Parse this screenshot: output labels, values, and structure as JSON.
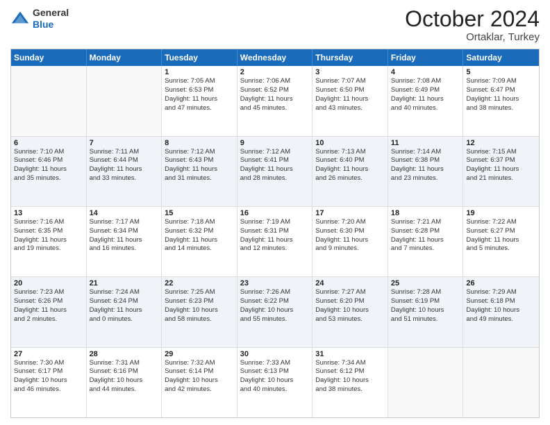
{
  "logo": {
    "general": "General",
    "blue": "Blue"
  },
  "title": "October 2024",
  "location": "Ortaklar, Turkey",
  "weekdays": [
    "Sunday",
    "Monday",
    "Tuesday",
    "Wednesday",
    "Thursday",
    "Friday",
    "Saturday"
  ],
  "rows": [
    [
      {
        "day": "",
        "lines": []
      },
      {
        "day": "",
        "lines": []
      },
      {
        "day": "1",
        "lines": [
          "Sunrise: 7:05 AM",
          "Sunset: 6:53 PM",
          "Daylight: 11 hours",
          "and 47 minutes."
        ]
      },
      {
        "day": "2",
        "lines": [
          "Sunrise: 7:06 AM",
          "Sunset: 6:52 PM",
          "Daylight: 11 hours",
          "and 45 minutes."
        ]
      },
      {
        "day": "3",
        "lines": [
          "Sunrise: 7:07 AM",
          "Sunset: 6:50 PM",
          "Daylight: 11 hours",
          "and 43 minutes."
        ]
      },
      {
        "day": "4",
        "lines": [
          "Sunrise: 7:08 AM",
          "Sunset: 6:49 PM",
          "Daylight: 11 hours",
          "and 40 minutes."
        ]
      },
      {
        "day": "5",
        "lines": [
          "Sunrise: 7:09 AM",
          "Sunset: 6:47 PM",
          "Daylight: 11 hours",
          "and 38 minutes."
        ]
      }
    ],
    [
      {
        "day": "6",
        "lines": [
          "Sunrise: 7:10 AM",
          "Sunset: 6:46 PM",
          "Daylight: 11 hours",
          "and 35 minutes."
        ]
      },
      {
        "day": "7",
        "lines": [
          "Sunrise: 7:11 AM",
          "Sunset: 6:44 PM",
          "Daylight: 11 hours",
          "and 33 minutes."
        ]
      },
      {
        "day": "8",
        "lines": [
          "Sunrise: 7:12 AM",
          "Sunset: 6:43 PM",
          "Daylight: 11 hours",
          "and 31 minutes."
        ]
      },
      {
        "day": "9",
        "lines": [
          "Sunrise: 7:12 AM",
          "Sunset: 6:41 PM",
          "Daylight: 11 hours",
          "and 28 minutes."
        ]
      },
      {
        "day": "10",
        "lines": [
          "Sunrise: 7:13 AM",
          "Sunset: 6:40 PM",
          "Daylight: 11 hours",
          "and 26 minutes."
        ]
      },
      {
        "day": "11",
        "lines": [
          "Sunrise: 7:14 AM",
          "Sunset: 6:38 PM",
          "Daylight: 11 hours",
          "and 23 minutes."
        ]
      },
      {
        "day": "12",
        "lines": [
          "Sunrise: 7:15 AM",
          "Sunset: 6:37 PM",
          "Daylight: 11 hours",
          "and 21 minutes."
        ]
      }
    ],
    [
      {
        "day": "13",
        "lines": [
          "Sunrise: 7:16 AM",
          "Sunset: 6:35 PM",
          "Daylight: 11 hours",
          "and 19 minutes."
        ]
      },
      {
        "day": "14",
        "lines": [
          "Sunrise: 7:17 AM",
          "Sunset: 6:34 PM",
          "Daylight: 11 hours",
          "and 16 minutes."
        ]
      },
      {
        "day": "15",
        "lines": [
          "Sunrise: 7:18 AM",
          "Sunset: 6:32 PM",
          "Daylight: 11 hours",
          "and 14 minutes."
        ]
      },
      {
        "day": "16",
        "lines": [
          "Sunrise: 7:19 AM",
          "Sunset: 6:31 PM",
          "Daylight: 11 hours",
          "and 12 minutes."
        ]
      },
      {
        "day": "17",
        "lines": [
          "Sunrise: 7:20 AM",
          "Sunset: 6:30 PM",
          "Daylight: 11 hours",
          "and 9 minutes."
        ]
      },
      {
        "day": "18",
        "lines": [
          "Sunrise: 7:21 AM",
          "Sunset: 6:28 PM",
          "Daylight: 11 hours",
          "and 7 minutes."
        ]
      },
      {
        "day": "19",
        "lines": [
          "Sunrise: 7:22 AM",
          "Sunset: 6:27 PM",
          "Daylight: 11 hours",
          "and 5 minutes."
        ]
      }
    ],
    [
      {
        "day": "20",
        "lines": [
          "Sunrise: 7:23 AM",
          "Sunset: 6:26 PM",
          "Daylight: 11 hours",
          "and 2 minutes."
        ]
      },
      {
        "day": "21",
        "lines": [
          "Sunrise: 7:24 AM",
          "Sunset: 6:24 PM",
          "Daylight: 11 hours",
          "and 0 minutes."
        ]
      },
      {
        "day": "22",
        "lines": [
          "Sunrise: 7:25 AM",
          "Sunset: 6:23 PM",
          "Daylight: 10 hours",
          "and 58 minutes."
        ]
      },
      {
        "day": "23",
        "lines": [
          "Sunrise: 7:26 AM",
          "Sunset: 6:22 PM",
          "Daylight: 10 hours",
          "and 55 minutes."
        ]
      },
      {
        "day": "24",
        "lines": [
          "Sunrise: 7:27 AM",
          "Sunset: 6:20 PM",
          "Daylight: 10 hours",
          "and 53 minutes."
        ]
      },
      {
        "day": "25",
        "lines": [
          "Sunrise: 7:28 AM",
          "Sunset: 6:19 PM",
          "Daylight: 10 hours",
          "and 51 minutes."
        ]
      },
      {
        "day": "26",
        "lines": [
          "Sunrise: 7:29 AM",
          "Sunset: 6:18 PM",
          "Daylight: 10 hours",
          "and 49 minutes."
        ]
      }
    ],
    [
      {
        "day": "27",
        "lines": [
          "Sunrise: 7:30 AM",
          "Sunset: 6:17 PM",
          "Daylight: 10 hours",
          "and 46 minutes."
        ]
      },
      {
        "day": "28",
        "lines": [
          "Sunrise: 7:31 AM",
          "Sunset: 6:16 PM",
          "Daylight: 10 hours",
          "and 44 minutes."
        ]
      },
      {
        "day": "29",
        "lines": [
          "Sunrise: 7:32 AM",
          "Sunset: 6:14 PM",
          "Daylight: 10 hours",
          "and 42 minutes."
        ]
      },
      {
        "day": "30",
        "lines": [
          "Sunrise: 7:33 AM",
          "Sunset: 6:13 PM",
          "Daylight: 10 hours",
          "and 40 minutes."
        ]
      },
      {
        "day": "31",
        "lines": [
          "Sunrise: 7:34 AM",
          "Sunset: 6:12 PM",
          "Daylight: 10 hours",
          "and 38 minutes."
        ]
      },
      {
        "day": "",
        "lines": []
      },
      {
        "day": "",
        "lines": []
      }
    ]
  ]
}
